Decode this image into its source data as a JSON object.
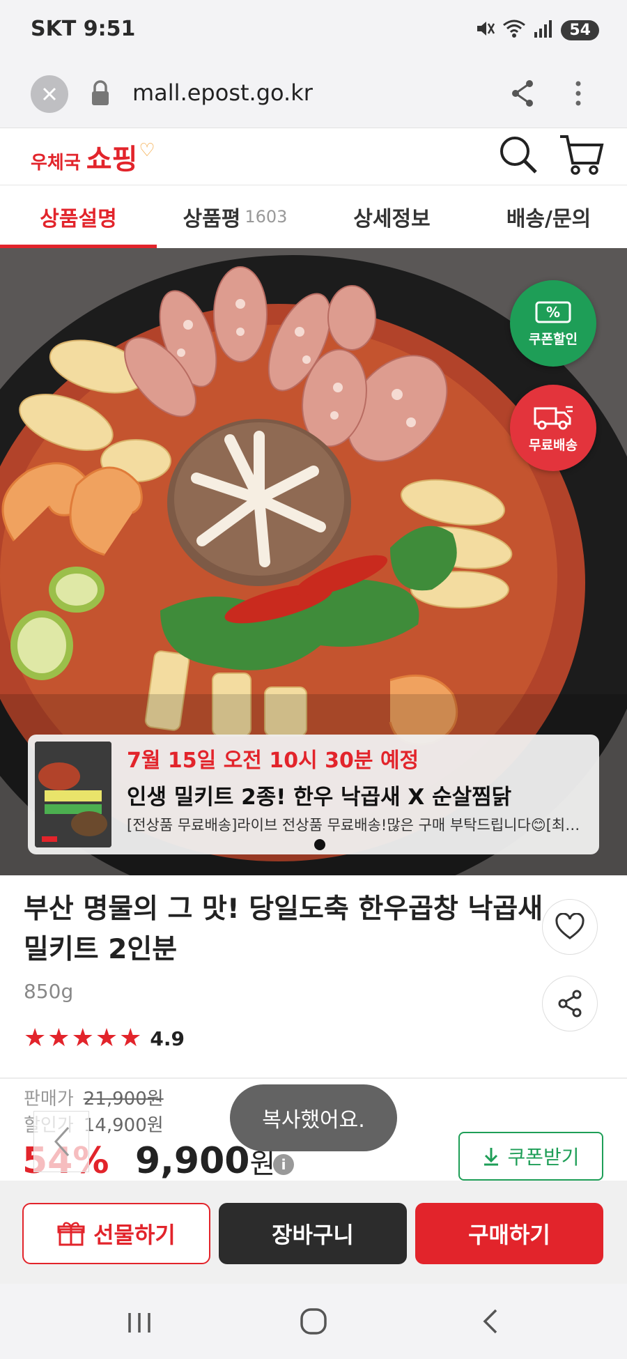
{
  "status_bar": {
    "carrier_time": "SKT 9:51",
    "battery": "54"
  },
  "browser": {
    "url": "mall.epost.go.kr"
  },
  "site": {
    "logo_small": "우체국",
    "logo_big": "쇼핑"
  },
  "tabs": [
    {
      "label": "상품설명",
      "count": ""
    },
    {
      "label": "상품평",
      "count": "1603"
    },
    {
      "label": "상세정보",
      "count": ""
    },
    {
      "label": "배송/문의",
      "count": ""
    }
  ],
  "badges": {
    "coupon": "쿠폰할인",
    "free_shipping": "무료배송"
  },
  "live_banner": {
    "date": "7월 15일 오전 10시 30분 예정",
    "title": "인생 밀키트 2종! 한우 낙곱새 X 순살찜닭",
    "description": "[전상품 무료배송]라이브 전상품 무료배송!많은 구매 부탁드립니다😊[최대 할인 혜..."
  },
  "product": {
    "title": "부산 명물의 그 맛! 당일도축 한우곱창 낙곱새 밀키트 2인분",
    "weight": "850g",
    "rating": "4.9",
    "rating_stars": 5
  },
  "price": {
    "sale_label": "판매가",
    "sale_value": "21,900원",
    "discount_label": "할인가",
    "discount_value": "14,900원",
    "discount_rate": "54%",
    "final_value": "9,900",
    "final_unit": "원",
    "info_glyph": "i",
    "coupon_button": "쿠폰받기"
  },
  "toast": "복사했어요.",
  "actions": {
    "gift": "선물하기",
    "cart": "장바구니",
    "buy": "구매하기"
  },
  "colors": {
    "brand_red": "#e2242b",
    "coupon_green": "#1e9e57",
    "dark": "#2c2c2c"
  }
}
